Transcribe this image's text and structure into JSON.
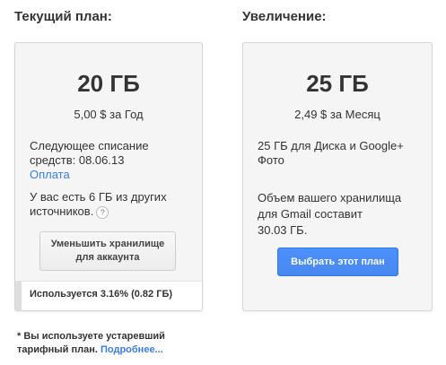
{
  "current": {
    "heading": "Текущий план:",
    "size": "20 ГБ",
    "price": "5,00 $ за Год",
    "billing_line1": "Следующее списание",
    "billing_line2": "средств: 08.06.13",
    "payment_link": "Оплата",
    "extra_line1": "У вас есть 6 ГБ из других",
    "extra_line2": "источников.",
    "help_glyph": "?",
    "downgrade_line1": "Уменьшить хранилище",
    "downgrade_line2": "для аккаунта",
    "usage_text": "Используется 3.16% (0.82 ГБ)",
    "usage_percent": 3.16
  },
  "upgrade": {
    "heading": "Увеличение:",
    "size": "25 ГБ",
    "price": "2,49 $ за Месяц",
    "desc_line1": "25 ГБ для Диска и Google+",
    "desc_line2": "Фото",
    "gmail_line1": "Объем вашего хранилища",
    "gmail_line2": "для Gmail составит",
    "gmail_line3": "30.03 ГБ.",
    "select_button": "Выбрать этот план"
  },
  "footnote": {
    "text_line1": "* Вы используете устаревший",
    "text_line2": "тарифный план.",
    "more_link": "Подробнее..."
  }
}
